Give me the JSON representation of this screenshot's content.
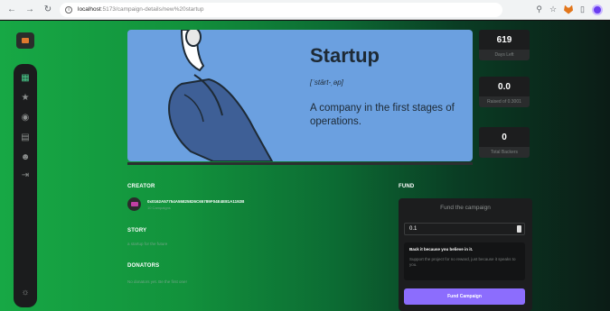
{
  "browser": {
    "url_host": "localhost",
    "url_path": ":5173/campaign-details/new%20startup"
  },
  "campaign": {
    "hero_title": "Startup",
    "hero_phonetic": "[ˈstärt-ˌəp]",
    "hero_definition": "A company in the first stages of operations.",
    "progress_fraction": 0.0
  },
  "stats": [
    {
      "value": "619",
      "label": "Days Left"
    },
    {
      "value": "0.0",
      "label": "Raised of 0.3001"
    },
    {
      "value": "0",
      "label": "Total Backers"
    }
  ],
  "creator": {
    "heading": "CREATOR",
    "address": "0x0162A57754A55825826C65789F04E4E81A1192B",
    "subtitle": "10 Campaigns"
  },
  "story": {
    "heading": "STORY",
    "text": "a startup for the future"
  },
  "donators": {
    "heading": "DONATORS",
    "empty_text": "No donators yet. Be the first one!"
  },
  "fund": {
    "heading": "FUND",
    "panel_title": "Fund the campaign",
    "amount_value": "0.1",
    "back_title": "Back it because you believe in it.",
    "back_desc": "Support the project for no reward, just because it speaks to you.",
    "button_label": "Fund Campaign"
  },
  "colors": {
    "accent_green": "#4acd8d",
    "button_purple": "#8c6dfd",
    "hero_blue": "#6ba0e0"
  }
}
